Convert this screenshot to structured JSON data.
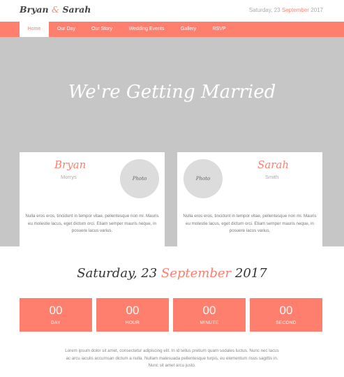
{
  "brand": {
    "first": "Bryan",
    "amp": "&",
    "second": "Sarah"
  },
  "header": {
    "date_prefix": "Saturday, 23 ",
    "date_month": "September",
    "date_suffix": " 2017"
  },
  "nav": {
    "items": [
      {
        "label": "Home",
        "active": true
      },
      {
        "label": "Our Day"
      },
      {
        "label": "Our Story"
      },
      {
        "label": "Wedding Events"
      },
      {
        "label": "Gallery"
      },
      {
        "label": "RSVP"
      }
    ]
  },
  "hero": {
    "title": "We're Getting Married"
  },
  "groom": {
    "name": "Bryan",
    "surname": "Morrys",
    "photo_label": "Photo",
    "bio": "Nulla eros eros, tincidunt in tempor vitae, pellentesque non mi. Mauris eu molestie lacus, eget dictum orci. Etiam semper mauris neque, in posuere lacus varius."
  },
  "bride": {
    "name": "Sarah",
    "surname": "Smith",
    "photo_label": "Photo",
    "bio": "Nulla eros eros, tincidunt in tempor vitae, pellentesque non mi. Mauris eu molestie lacus, eget dictum orci. Etiam semper mauris neque, in posuere lacus varius."
  },
  "event_date": {
    "prefix": "Saturday, 23 ",
    "month": "September",
    "suffix": " 2017"
  },
  "countdown": [
    {
      "value": "00",
      "label": "DAY"
    },
    {
      "value": "00",
      "label": "HOUR"
    },
    {
      "value": "00",
      "label": "MINUTE"
    },
    {
      "value": "00",
      "label": "SECOND"
    }
  ],
  "footer": {
    "text": "Lorem ipsum dolor sit amet, consectetur adipiscing elit. In id tellus pretium quam sodales luctus. Nunc nec lacus ac arcu iaculis accumsan dictum a nulla. Nullam malesuada pellentesque turpis, eu elementum risus sagittis in. Nunc sit amet arcu justo."
  },
  "colors": {
    "accent": "#ff7f6e",
    "hero_bg": "#c6c6c6",
    "photo_bg": "#dcdcdc"
  }
}
